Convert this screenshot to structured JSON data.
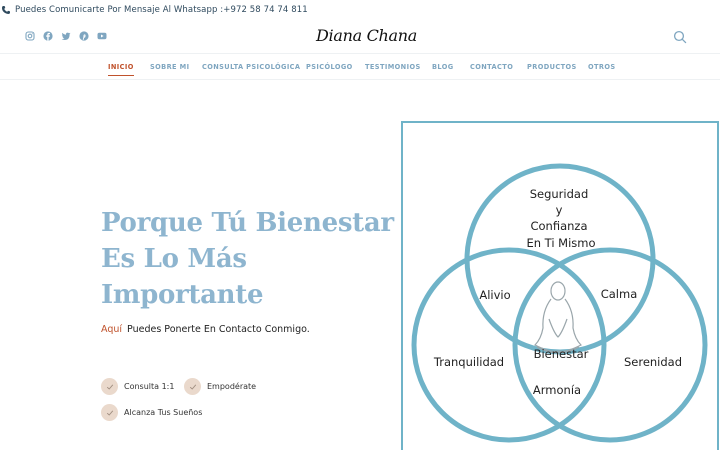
{
  "topbar": {
    "contact_text": "Puedes Comunicarte Por Mensaje Al Whatsapp :+972 58 74 74 811"
  },
  "header": {
    "logo": "Diana Chana",
    "social_icons": [
      "instagram-icon",
      "facebook-icon",
      "twitter-icon",
      "pinterest-icon",
      "youtube-icon"
    ]
  },
  "nav": {
    "items": [
      {
        "label": "INICIO",
        "active": true
      },
      {
        "label": "SOBRE MI"
      },
      {
        "label": "CONSULTA PSICOLÓGICA"
      },
      {
        "label": "PSICÓLOGO"
      },
      {
        "label": "TESTIMONIOS"
      },
      {
        "label": "BLOG"
      },
      {
        "label": "CONTACTO"
      },
      {
        "label": "PRODUCTOS"
      },
      {
        "label": "OTROS"
      }
    ]
  },
  "hero": {
    "title_lines": [
      "Porque Tú Bienestar",
      "Es Lo Más",
      "Importante"
    ],
    "intro_accent": "Aquí",
    "intro_text": "Puedes Ponerte En Contacto Conmigo.",
    "checks": [
      "Consulta 1:1",
      "Empodérate",
      "Alcanza Tus Sueños"
    ]
  },
  "venn": {
    "top_lines": [
      "Seguridad",
      "y",
      "Confianza",
      "En Ti Mismo"
    ],
    "alivio": "Alivio",
    "calma": "Calma",
    "tranquilidad": "Tranquilidad",
    "serenidad": "Serenidad",
    "bienestar": "Bienestar",
    "armonia": "Armonía"
  },
  "colors": {
    "accent": "#c0522c",
    "nav": "#7fa6c0",
    "title": "#8eb5cf",
    "venn": "#6fb3c8",
    "check_bg": "#ead9cc"
  }
}
